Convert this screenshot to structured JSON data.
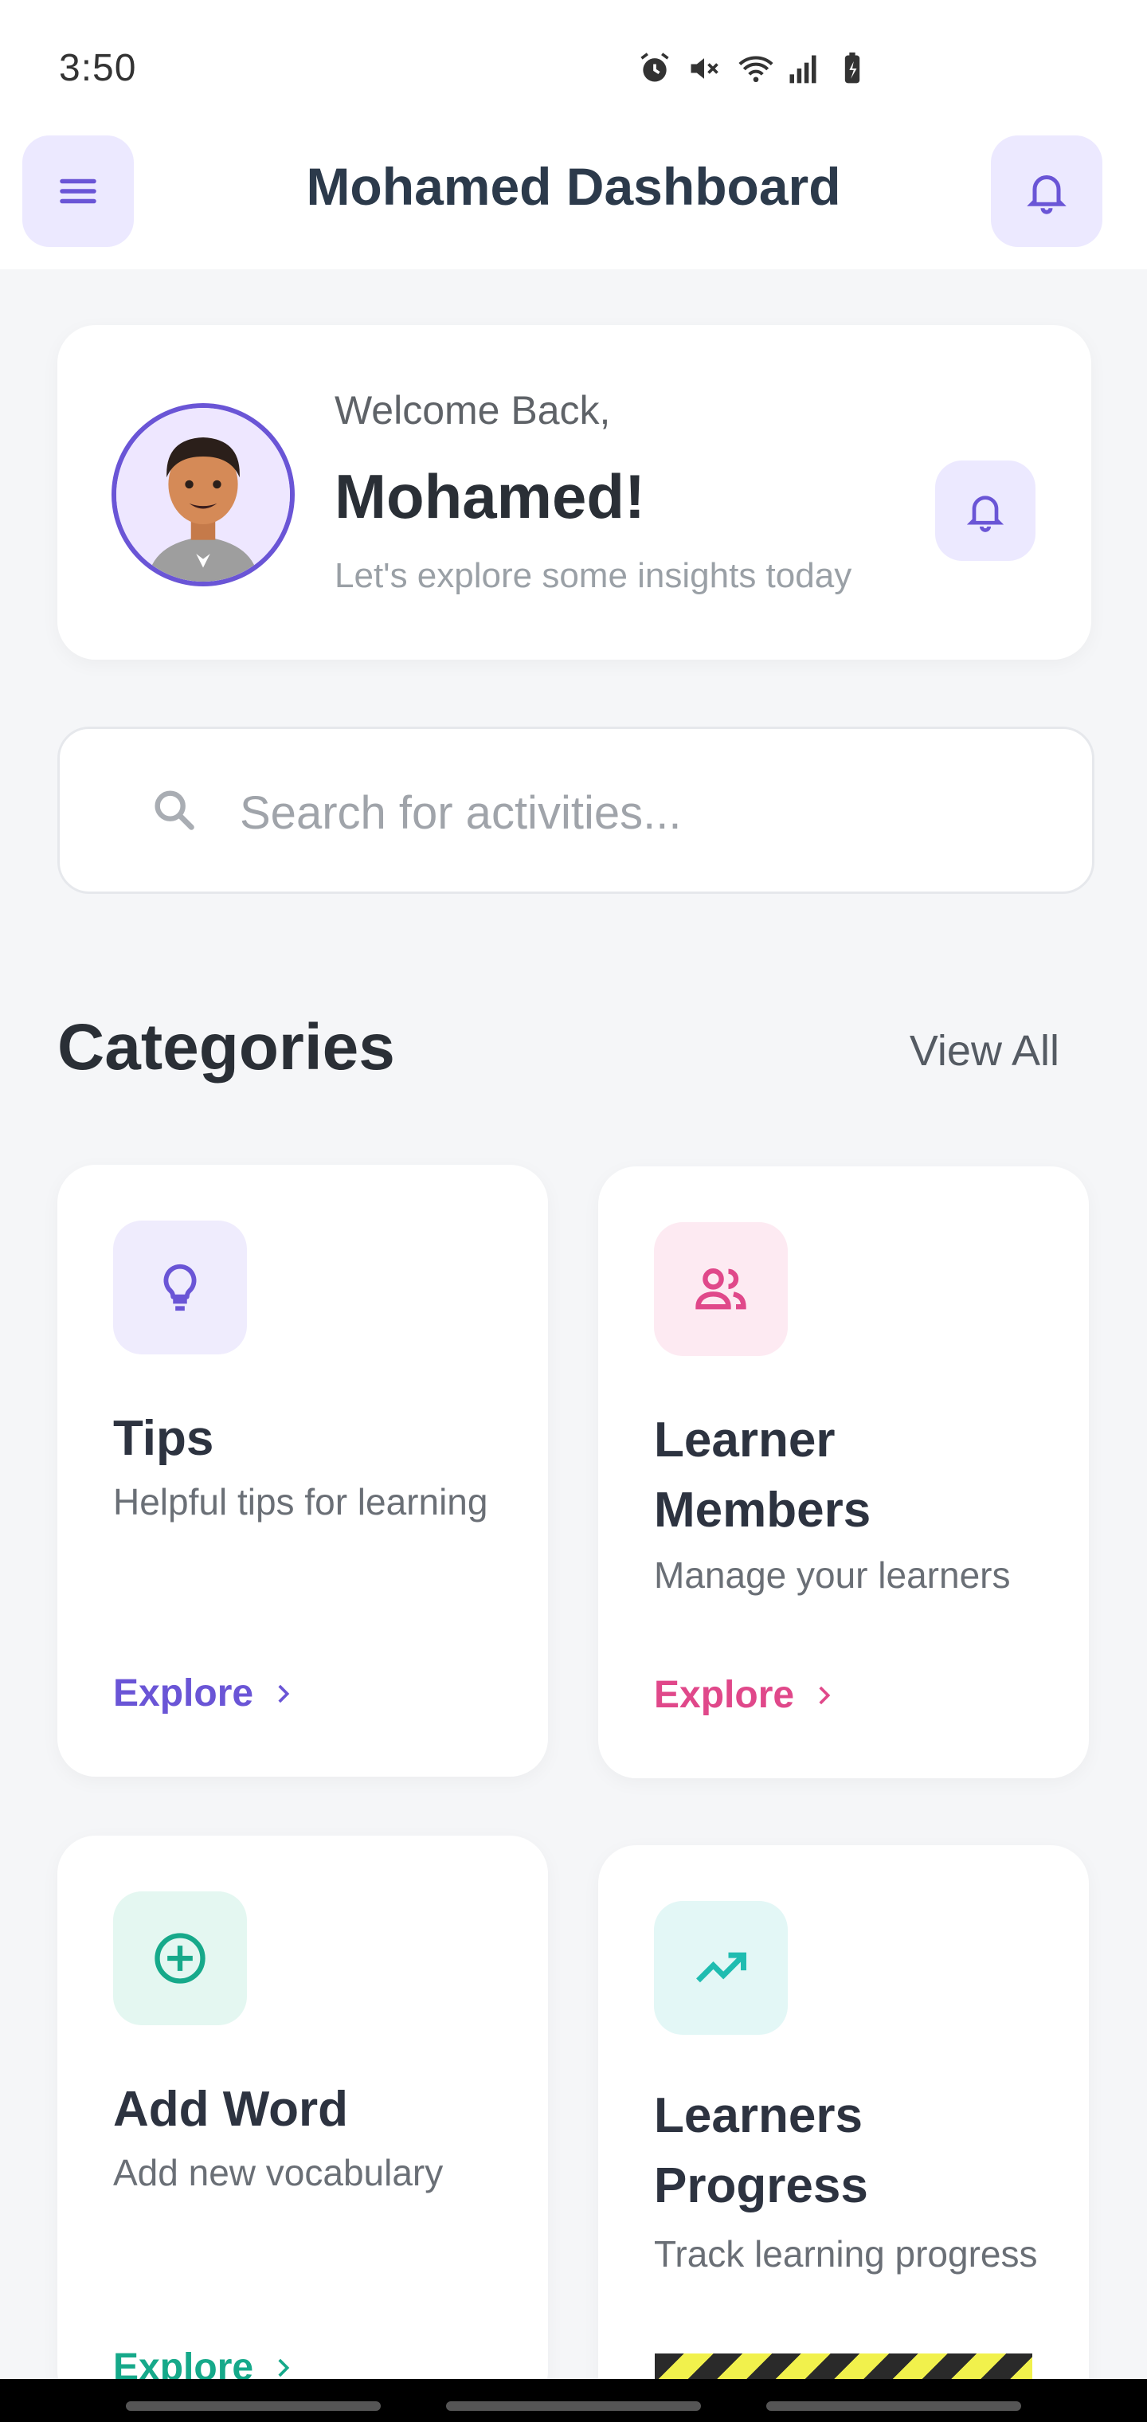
{
  "status_bar": {
    "time": "3:50"
  },
  "app_bar": {
    "title": "Mohamed Dashboard"
  },
  "welcome": {
    "greeting": "Welcome Back,",
    "name": "Mohamed!",
    "subtitle": "Let's explore some insights today"
  },
  "search": {
    "placeholder": "Search for activities..."
  },
  "categories_section": {
    "title": "Categories",
    "view_all": "View All"
  },
  "categories": [
    {
      "title": "Tips",
      "description": "Helpful tips for learning",
      "cta": "Explore",
      "icon": "lightbulb-icon",
      "accent": "#6a55d6",
      "icon_bg": "#efecfd"
    },
    {
      "title": "Learner Members",
      "description": "Manage your learners",
      "cta": "Explore",
      "icon": "people-icon",
      "accent": "#e0488a",
      "icon_bg": "#fdeaf2"
    },
    {
      "title": "Add Word",
      "description": "Add new vocabulary",
      "cta": "Explore",
      "icon": "add-circle-icon",
      "accent": "#16a98a",
      "icon_bg": "#e4f7f1"
    },
    {
      "title": "Learners Progress",
      "description": "Track learning progress",
      "icon": "trending-up-icon",
      "accent": "#1fbcb0",
      "icon_bg": "#e3f7f6"
    }
  ],
  "colors": {
    "primary": "#6a55d6",
    "background": "#f5f6f8"
  }
}
